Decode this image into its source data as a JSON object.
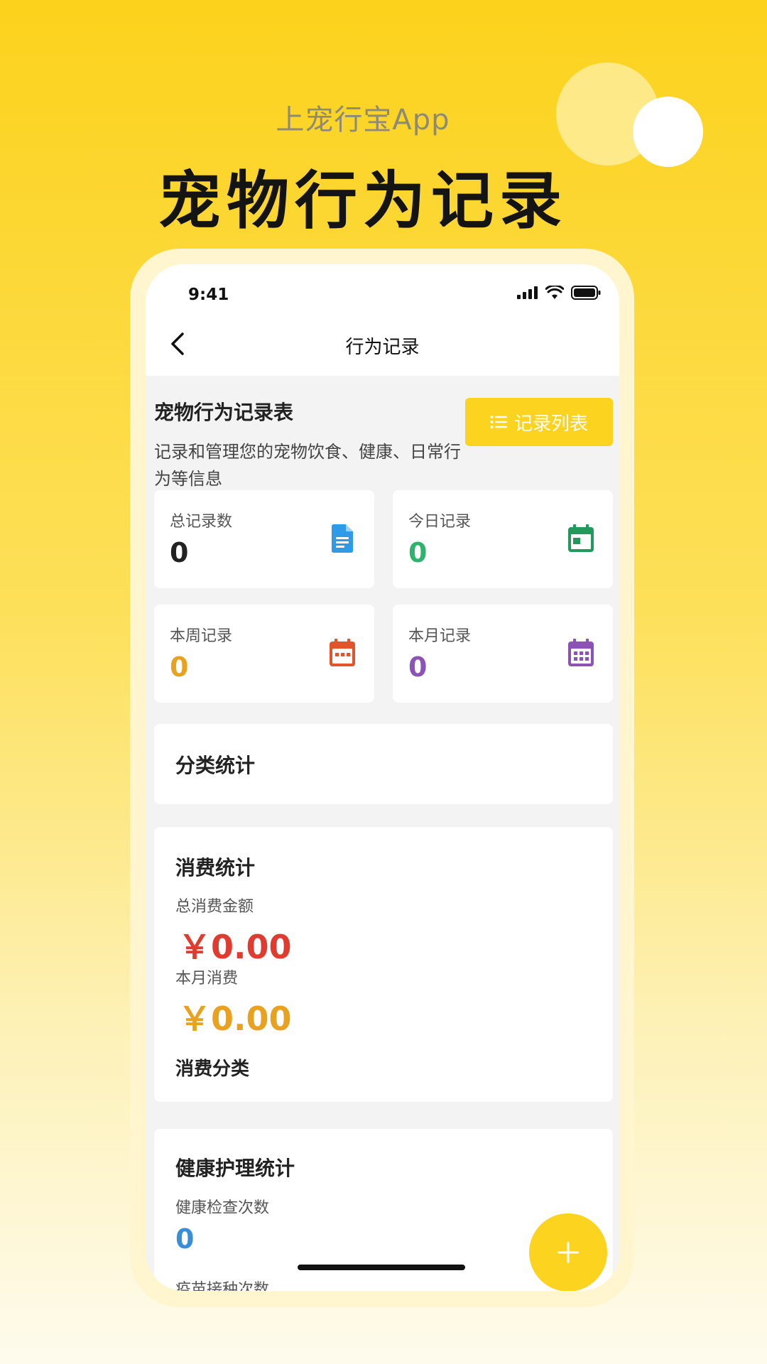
{
  "promo": {
    "subtitle": "上宠行宝App",
    "title": "宠物行为记录"
  },
  "status_bar": {
    "time": "9:41",
    "icons": [
      "signal-icon",
      "wifi-icon",
      "battery-icon"
    ]
  },
  "nav": {
    "back_icon": "chevron-left-icon",
    "title": "行为记录"
  },
  "page": {
    "heading": "宠物行为记录表",
    "description": "记录和管理您的宠物饮食、健康、日常行为等信息",
    "list_button_label": "记录列表",
    "list_button_icon": "list-icon"
  },
  "stats": [
    {
      "label": "总记录数",
      "value": "0",
      "color": "#222222",
      "icon": "document-icon",
      "icon_color": "#2d9be8"
    },
    {
      "label": "今日记录",
      "value": "0",
      "color": "#2db36b",
      "icon": "calendar-today-icon",
      "icon_color": "#239a5b"
    },
    {
      "label": "本周记录",
      "value": "0",
      "color": "#e8a21f",
      "icon": "calendar-week-icon",
      "icon_color": "#e2542a"
    },
    {
      "label": "本月记录",
      "value": "0",
      "color": "#8d52b6",
      "icon": "calendar-month-icon",
      "icon_color": "#8d52b6"
    }
  ],
  "category_stats": {
    "title": "分类统计"
  },
  "consumption": {
    "title": "消费统计",
    "total_label": "总消费金额",
    "total_value": "￥0.00",
    "total_color": "#e03b2e",
    "month_label": "本月消费",
    "month_value": "￥0.00",
    "month_color": "#e8a21f",
    "category_label": "消费分类"
  },
  "health": {
    "title": "健康护理统计",
    "check_label": "健康检查次数",
    "check_value": "0",
    "check_color": "#3a8ed6",
    "vaccine_label": "疫苗接种次数"
  },
  "fab": {
    "icon": "plus-icon"
  },
  "colors": {
    "accent": "#fcd31f"
  }
}
